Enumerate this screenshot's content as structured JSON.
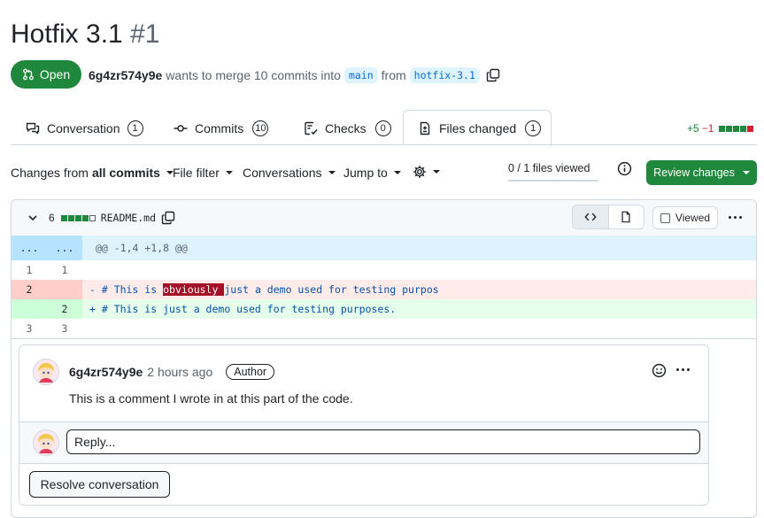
{
  "pr": {
    "title": "Hotfix 3.1",
    "number": "#1",
    "state": "Open",
    "author": "6g4zr574y9e",
    "merge_text": "wants to merge 10 commits into",
    "base_branch": "main",
    "from_text": "from",
    "head_branch": "hotfix-3.1"
  },
  "tabs": [
    {
      "label": "Conversation",
      "count": "1",
      "icon": "comment-discussion-icon"
    },
    {
      "label": "Commits",
      "count": "10",
      "icon": "git-commit-icon"
    },
    {
      "label": "Checks",
      "count": "0",
      "icon": "checklist-icon"
    },
    {
      "label": "Files changed",
      "count": "1",
      "icon": "file-diff-icon",
      "active": true
    }
  ],
  "diffstat": {
    "additions": "+5",
    "deletions": "−1"
  },
  "toolbar": {
    "changes_prefix": "Changes from",
    "changes_value": "all commits",
    "file_filter": "File filter",
    "conversations": "Conversations",
    "jump_to": "Jump to",
    "files_viewed": "0 / 1 files viewed",
    "files_viewed_fraction": 0,
    "review_button": "Review changes"
  },
  "file": {
    "changes": "6",
    "name": "README.md",
    "viewed_label": "Viewed",
    "diff": {
      "hunk": "@@ -1,4 +1,8 @@",
      "hunk_ln": "...",
      "lines": [
        {
          "old": "1",
          "new": "1",
          "type": "context",
          "pre": " ",
          "hl": "",
          "post": ""
        },
        {
          "old": "2",
          "new": "",
          "type": "del",
          "pre": "- # This is ",
          "hl": "obviously ",
          "post": "just a demo used for testing purpos"
        },
        {
          "old": "",
          "new": "2",
          "type": "add",
          "pre": "+ # This is just a demo used for testing purposes.",
          "hl": "",
          "post": ""
        },
        {
          "old": "3",
          "new": "3",
          "type": "context",
          "pre": " ",
          "hl": "",
          "post": ""
        }
      ]
    }
  },
  "comment": {
    "author": "6g4zr574y9e",
    "time": "2 hours ago",
    "badge": "Author",
    "body": "This is a comment I wrote in at this part of the code.",
    "reply_placeholder": "Reply...",
    "resolve_label": "Resolve conversation"
  },
  "colors": {
    "accent_green": "#1f883d",
    "link_blue": "#0969da",
    "deletion_red": "#cf222e"
  }
}
